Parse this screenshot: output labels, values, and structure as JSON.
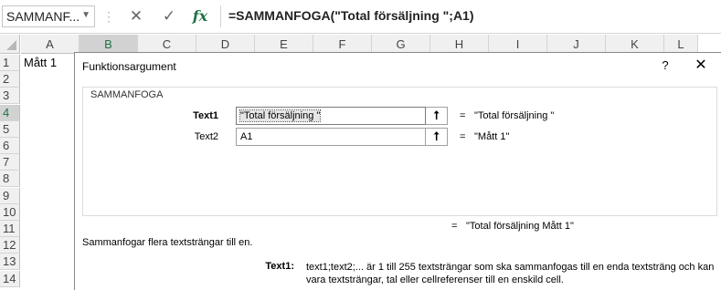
{
  "formula_bar": {
    "name_box": "SAMMANF...",
    "separator": "⋮",
    "cancel_glyph": "✕",
    "enter_glyph": "✓",
    "fx_label": "fx",
    "formula": "=SAMMANFOGA(\"Total försäljning \";A1)"
  },
  "grid": {
    "columns": [
      "A",
      "B",
      "C",
      "D",
      "E",
      "F",
      "G",
      "H",
      "I",
      "J",
      "K",
      "L"
    ],
    "rows": [
      "1",
      "2",
      "3",
      "4",
      "5",
      "6",
      "7",
      "8",
      "9",
      "10",
      "11",
      "12",
      "13",
      "14"
    ],
    "cell_a1": "Mått 1",
    "selected_column": "B",
    "selected_row": "4"
  },
  "dialog": {
    "title": "Funktionsargument",
    "help_label": "?",
    "close_label": "✕",
    "function_name": "SAMMANFOGA",
    "args": [
      {
        "label": "Text1",
        "value": "\"Total försäljning \"",
        "result": "\"Total försäljning \""
      },
      {
        "label": "Text2",
        "value": "A1",
        "result": "\"Mått 1\""
      }
    ],
    "collapse_glyph": "⭡",
    "equals": "=",
    "result": "\"Total försäljning Mått 1\"",
    "description": "Sammanfogar flera textsträngar till en.",
    "param_name": "Text1:",
    "param_description": "text1;text2;... är 1 till 255 textsträngar som ska sammanfogas till en enda textsträng och kan vara textsträngar, tal eller cellreferenser till en enskild cell."
  },
  "colors": {
    "accent_green": "#217346",
    "header_bg": "#f0f0f0",
    "header_selected_bg": "#d2d2d2"
  }
}
